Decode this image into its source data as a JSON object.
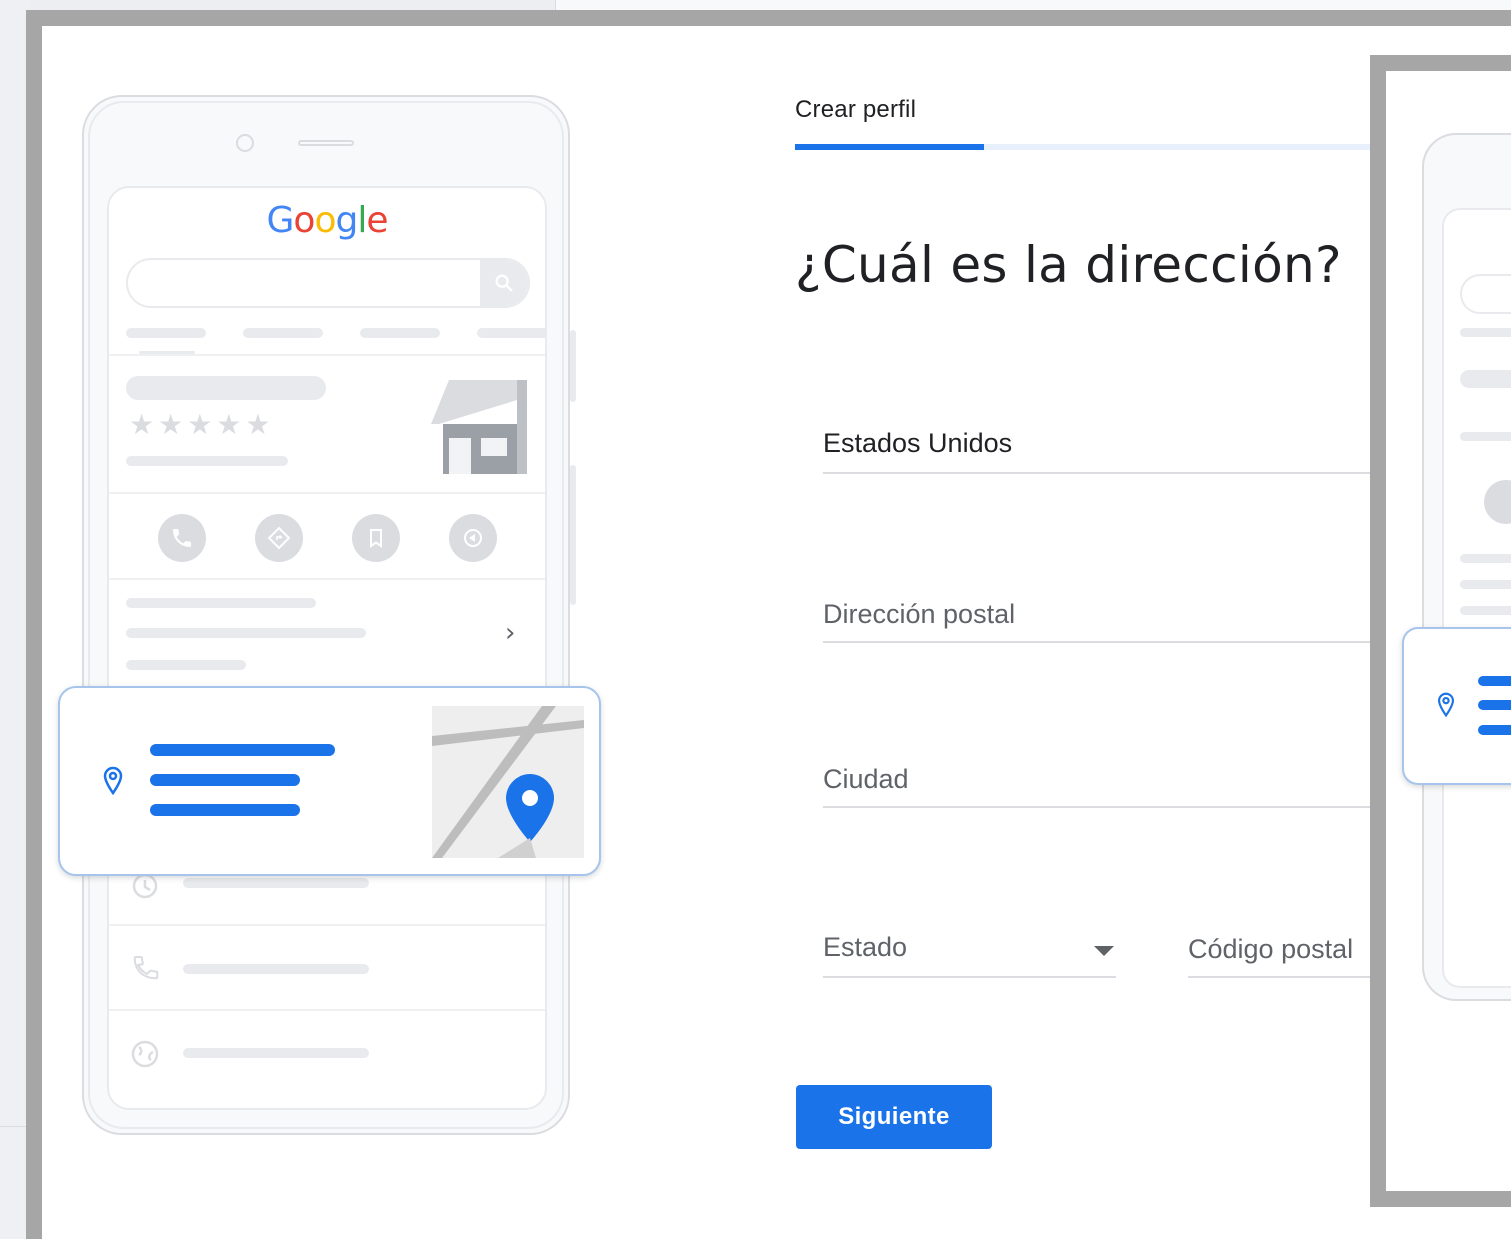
{
  "phone_mock": {
    "logo": {
      "letters": [
        "G",
        "o",
        "o",
        "g",
        "l",
        "e"
      ],
      "colors": [
        "#4285F4",
        "#EA4335",
        "#FBBC05",
        "#4285F4",
        "#34A853",
        "#EA4335"
      ]
    },
    "rating_stars": "★★★★★",
    "chevron": "›"
  },
  "form": {
    "tab_label": "Crear perfil",
    "progress_fraction": 0.32,
    "heading": "¿Cuál es la dirección?",
    "country_value": "Estados Unidos",
    "street_placeholder": "Dirección postal",
    "city_placeholder": "Ciudad",
    "state_placeholder": "Estado",
    "zip_placeholder": "Código postal",
    "next_button": "Siguiente"
  },
  "colors": {
    "accent": "#1a73e8",
    "frame": "#a6a6a6"
  }
}
